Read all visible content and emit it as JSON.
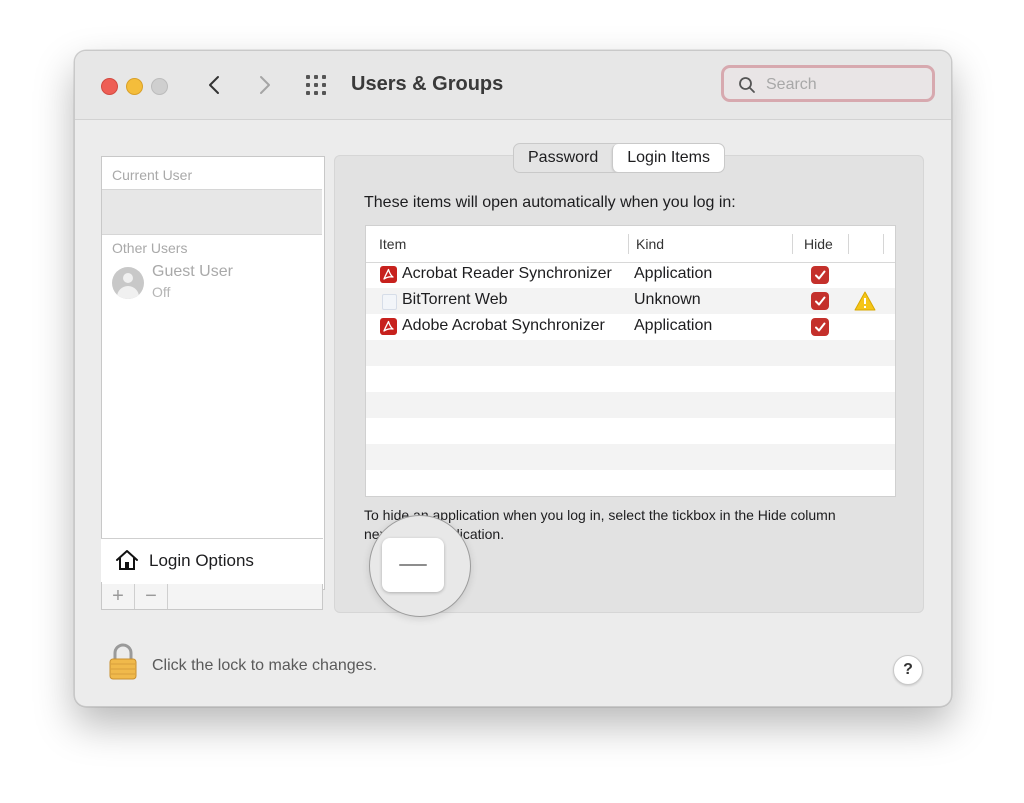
{
  "window": {
    "title": "Users & Groups",
    "search": {
      "placeholder": "Search",
      "value": ""
    }
  },
  "sidebar": {
    "current_user_header": "Current User",
    "other_users_header": "Other Users",
    "users": [
      {
        "name": "Guest User",
        "status": "Off"
      }
    ],
    "login_options_label": "Login Options",
    "add_label": "+",
    "remove_label": "−"
  },
  "tabs": [
    {
      "label": "Password",
      "active": false
    },
    {
      "label": "Login Items",
      "active": true
    }
  ],
  "login_items": {
    "heading": "These items will open automatically when you log in:",
    "columns": [
      "Item",
      "Kind",
      "Hide"
    ],
    "rows": [
      {
        "icon": "pdf-icon",
        "item": "Acrobat Reader Synchronizer",
        "kind": "Application",
        "hide": true,
        "warning": false
      },
      {
        "icon": "generic-app-icon",
        "item": "BitTorrent Web",
        "kind": "Unknown",
        "hide": true,
        "warning": true
      },
      {
        "icon": "pdf-icon",
        "item": "Adobe Acrobat Synchronizer",
        "kind": "Application",
        "hide": true,
        "warning": false
      }
    ],
    "hint_line1": "To hide an application when you log in, select the tickbox in the Hide column",
    "hint_line2": "next to the application."
  },
  "footer": {
    "lock_text": "Click the lock to make changes.",
    "help_label": "?"
  },
  "colors": {
    "close": "#ee5e55",
    "minimize": "#f4bd3b",
    "checkbox": "#c4302b",
    "search_focus_ring": "#d7a9af",
    "warning": "#f5c518"
  }
}
